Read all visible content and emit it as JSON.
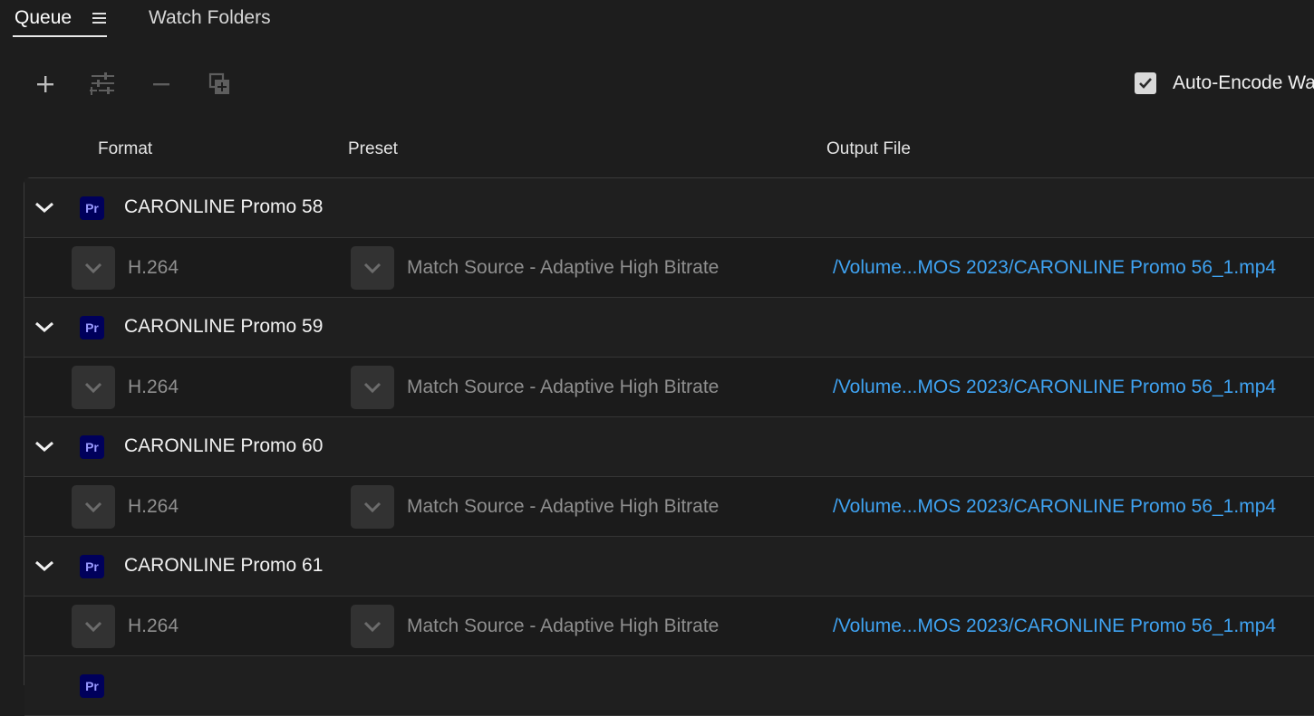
{
  "tabs": {
    "queue": "Queue",
    "watch_folders": "Watch Folders"
  },
  "toolbar": {
    "add_icon": "plus-icon",
    "settings_icon": "sliders-icon",
    "remove_icon": "minus-icon",
    "duplicate_icon": "duplicate-icon",
    "auto_encode_label": "Auto-Encode Wa",
    "auto_encode_checked": true
  },
  "columns": {
    "format": "Format",
    "preset": "Preset",
    "output": "Output File"
  },
  "colors": {
    "accent_link": "#3fa3f2",
    "premiere_badge_bg": "#00005b",
    "premiere_badge_text": "#9999ff"
  },
  "queue": [
    {
      "title": "CARONLINE Promo 58",
      "app_badge": "Pr",
      "format": "H.264",
      "preset": "Match Source - Adaptive High Bitrate",
      "output": "/Volume...MOS 2023/CARONLINE Promo 56_1.mp4"
    },
    {
      "title": "CARONLINE Promo 59",
      "app_badge": "Pr",
      "format": "H.264",
      "preset": "Match Source - Adaptive High Bitrate",
      "output": "/Volume...MOS 2023/CARONLINE Promo 56_1.mp4"
    },
    {
      "title": "CARONLINE Promo 60",
      "app_badge": "Pr",
      "format": "H.264",
      "preset": "Match Source - Adaptive High Bitrate",
      "output": "/Volume...MOS 2023/CARONLINE Promo 56_1.mp4"
    },
    {
      "title": "CARONLINE Promo 61",
      "app_badge": "Pr",
      "format": "H.264",
      "preset": "Match Source - Adaptive High Bitrate",
      "output": "/Volume...MOS 2023/CARONLINE Promo 56_1.mp4"
    },
    {
      "title": "",
      "app_badge": "Pr",
      "format": "",
      "preset": "",
      "output": ""
    }
  ]
}
